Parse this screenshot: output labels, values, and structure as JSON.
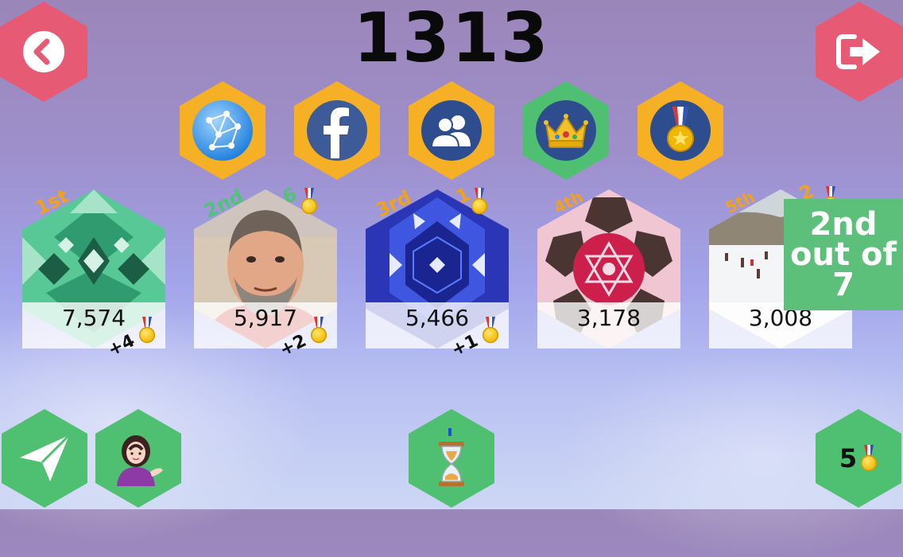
{
  "score": "1313",
  "colors": {
    "accent_red": "#e65a74",
    "hex_orange": "#f5b025",
    "hex_green": "#4fbf72",
    "rank_orange": "#f0a21f",
    "rank_green": "#52c27a"
  },
  "nav": {
    "back_icon": "chevron-left-icon",
    "exit_icon": "exit-arrow-icon"
  },
  "filters": [
    {
      "name": "global",
      "icon": "globe-network-icon",
      "active": false
    },
    {
      "name": "facebook",
      "icon": "facebook-icon",
      "active": false
    },
    {
      "name": "friends",
      "icon": "friends-icon",
      "active": false
    },
    {
      "name": "crown",
      "icon": "crown-icon",
      "active": true
    },
    {
      "name": "medal",
      "icon": "medal-icon",
      "active": false
    }
  ],
  "leaderboard": [
    {
      "rank": "1st",
      "score": "7,574",
      "gain": "+4",
      "medal_count": "",
      "avatar": "green-kaleidoscope"
    },
    {
      "rank": "2nd",
      "score": "5,917",
      "gain": "+2",
      "medal_count": "6",
      "avatar": "photo-man"
    },
    {
      "rank": "3rd",
      "score": "5,466",
      "gain": "+1",
      "medal_count": "1",
      "avatar": "blue-kaleidoscope"
    },
    {
      "rank": "4th",
      "score": "3,178",
      "gain": "",
      "medal_count": "",
      "avatar": "pink-kaleidoscope"
    },
    {
      "rank": "5th",
      "score": "3,008",
      "gain": "",
      "medal_count": "2",
      "avatar": "photo-ski-slope"
    }
  ],
  "position": {
    "line1": "2nd",
    "line2": "out of",
    "line3": "7"
  },
  "bottom": {
    "send_icon": "paper-plane-icon",
    "person_icon": "woman-tipping-hand-icon",
    "timer_icon": "hourglass-icon",
    "medals_total": "5"
  }
}
